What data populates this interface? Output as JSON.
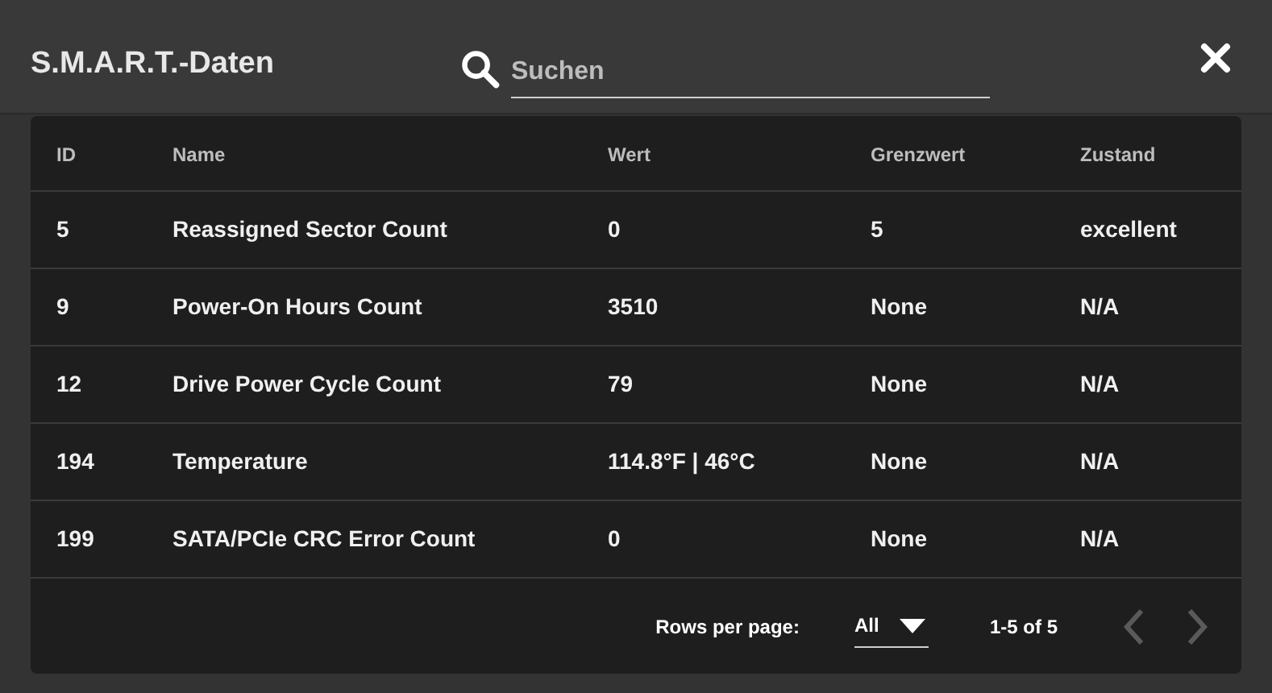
{
  "dialog": {
    "title": "S.M.A.R.T.-Daten",
    "search": {
      "placeholder": "Suchen"
    }
  },
  "table": {
    "columns": [
      "ID",
      "Name",
      "Wert",
      "Grenzwert",
      "Zustand"
    ],
    "rows": [
      [
        "5",
        "Reassigned Sector Count",
        "0",
        "5",
        "excellent"
      ],
      [
        "9",
        "Power-On Hours Count",
        "3510",
        "None",
        "N/A"
      ],
      [
        "12",
        "Drive Power Cycle Count",
        "79",
        "None",
        "N/A"
      ],
      [
        "194",
        "Temperature",
        "114.8°F | 46°C",
        "None",
        "N/A"
      ],
      [
        "199",
        "SATA/PCIe CRC Error Count",
        "0",
        "None",
        "N/A"
      ]
    ]
  },
  "pagination": {
    "rows_per_page_label": "Rows per page:",
    "rows_per_page": "All",
    "range": "1-5 of 5",
    "prev_disabled": true,
    "next_disabled": true
  }
}
